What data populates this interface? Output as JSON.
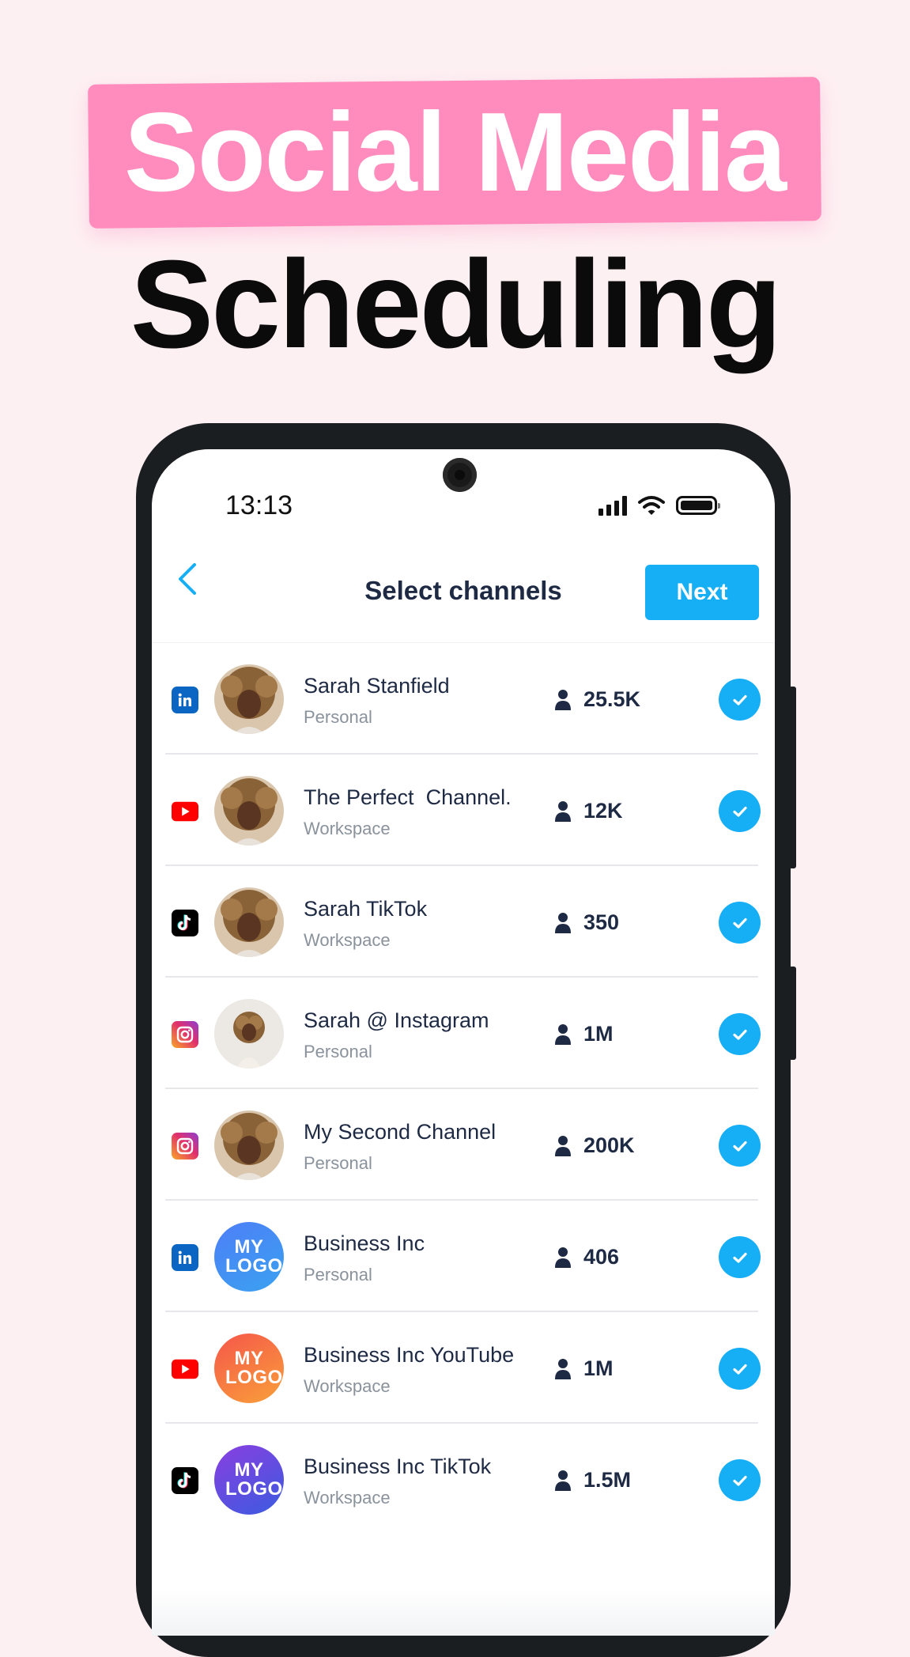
{
  "headline": {
    "line1": "Social Media",
    "line2": "Scheduling"
  },
  "status_bar": {
    "time": "13:13",
    "icons": [
      "signal-icon",
      "wifi-icon",
      "battery-icon"
    ]
  },
  "nav": {
    "back_icon": "chevron-left-icon",
    "title": "Select channels",
    "next_label": "Next"
  },
  "colors": {
    "accent": "#16aef5",
    "headline_pink": "#ff8cbd",
    "background": "#fdf0f3",
    "text_dark": "#1e2a44"
  },
  "channels": [
    {
      "network": "linkedin",
      "name": "Sarah Stanfield",
      "type": "Personal",
      "followers": "25.5K",
      "avatar": "photo",
      "selected": true
    },
    {
      "network": "youtube",
      "name": "The Perfect  Channel.",
      "type": "Workspace",
      "followers": "12K",
      "avatar": "photo",
      "selected": true
    },
    {
      "network": "tiktok",
      "name": "Sarah TikTok",
      "type": "Workspace",
      "followers": "350",
      "avatar": "photo",
      "selected": true
    },
    {
      "network": "instagram",
      "name": "Sarah @ Instagram",
      "type": "Personal",
      "followers": "1M",
      "avatar": "photo-light",
      "selected": true
    },
    {
      "network": "instagram",
      "name": "My Second Channel",
      "type": "Personal",
      "followers": "200K",
      "avatar": "photo",
      "selected": true
    },
    {
      "network": "linkedin",
      "name": "Business Inc",
      "type": "Personal",
      "followers": "406",
      "avatar": "logo-blue",
      "logo_text": "MY LOGO",
      "selected": true
    },
    {
      "network": "youtube",
      "name": "Business Inc YouTube",
      "type": "Workspace",
      "followers": "1M",
      "avatar": "logo-orange",
      "logo_text": "MY LOGO",
      "selected": true
    },
    {
      "network": "tiktok",
      "name": "Business Inc TikTok",
      "type": "Workspace",
      "followers": "1.5M",
      "avatar": "logo-purple",
      "logo_text": "MY LOGO",
      "selected": true
    }
  ]
}
